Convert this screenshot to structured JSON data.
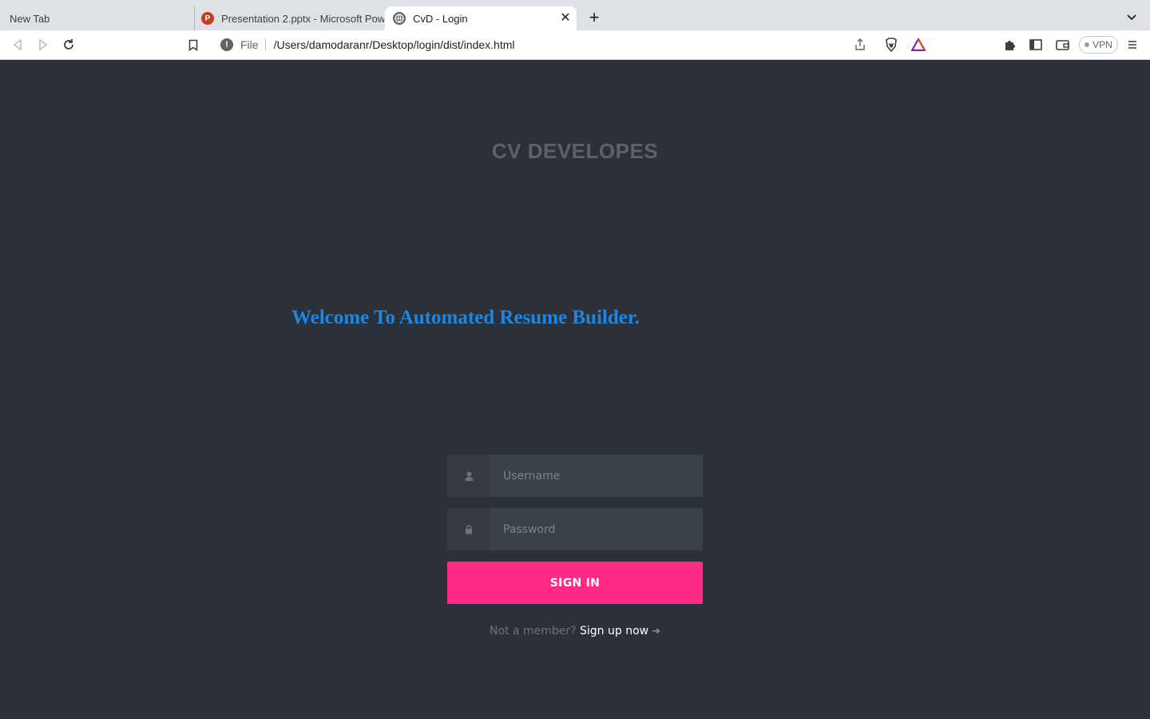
{
  "browser": {
    "tabs": [
      {
        "title": "New Tab"
      },
      {
        "title": "Presentation 2.pptx - Microsoft PowerPoint",
        "favicon_letter": "P"
      },
      {
        "title": "CvD - Login"
      }
    ],
    "address": {
      "scheme_label": "File",
      "url": "/Users/damodaranr/Desktop/login/dist/index.html"
    },
    "vpn_label": "VPN",
    "icons": {
      "back": "back-icon",
      "forward": "forward-icon",
      "reload": "reload-icon",
      "bookmark": "bookmark-icon",
      "share": "share-icon",
      "brave_shield": "brave-shield-icon",
      "brave_rewards": "brave-rewards-icon",
      "extensions": "puzzle-icon",
      "sidebar": "sidebar-icon",
      "wallet": "wallet-icon",
      "menu": "menu-icon"
    }
  },
  "page": {
    "brand": "CV DEVELOPES",
    "welcome": "Welcome To Automated Resume Builder.",
    "login": {
      "username_placeholder": "Username",
      "password_placeholder": "Password",
      "signin_label": "SIGN IN",
      "signup_prompt": "Not a member?",
      "signup_link": "Sign up now"
    }
  },
  "colors": {
    "page_bg": "#2c3038",
    "accent": "#ff2a85",
    "welcome": "#1d86e0",
    "field_bg": "#3b4148"
  }
}
